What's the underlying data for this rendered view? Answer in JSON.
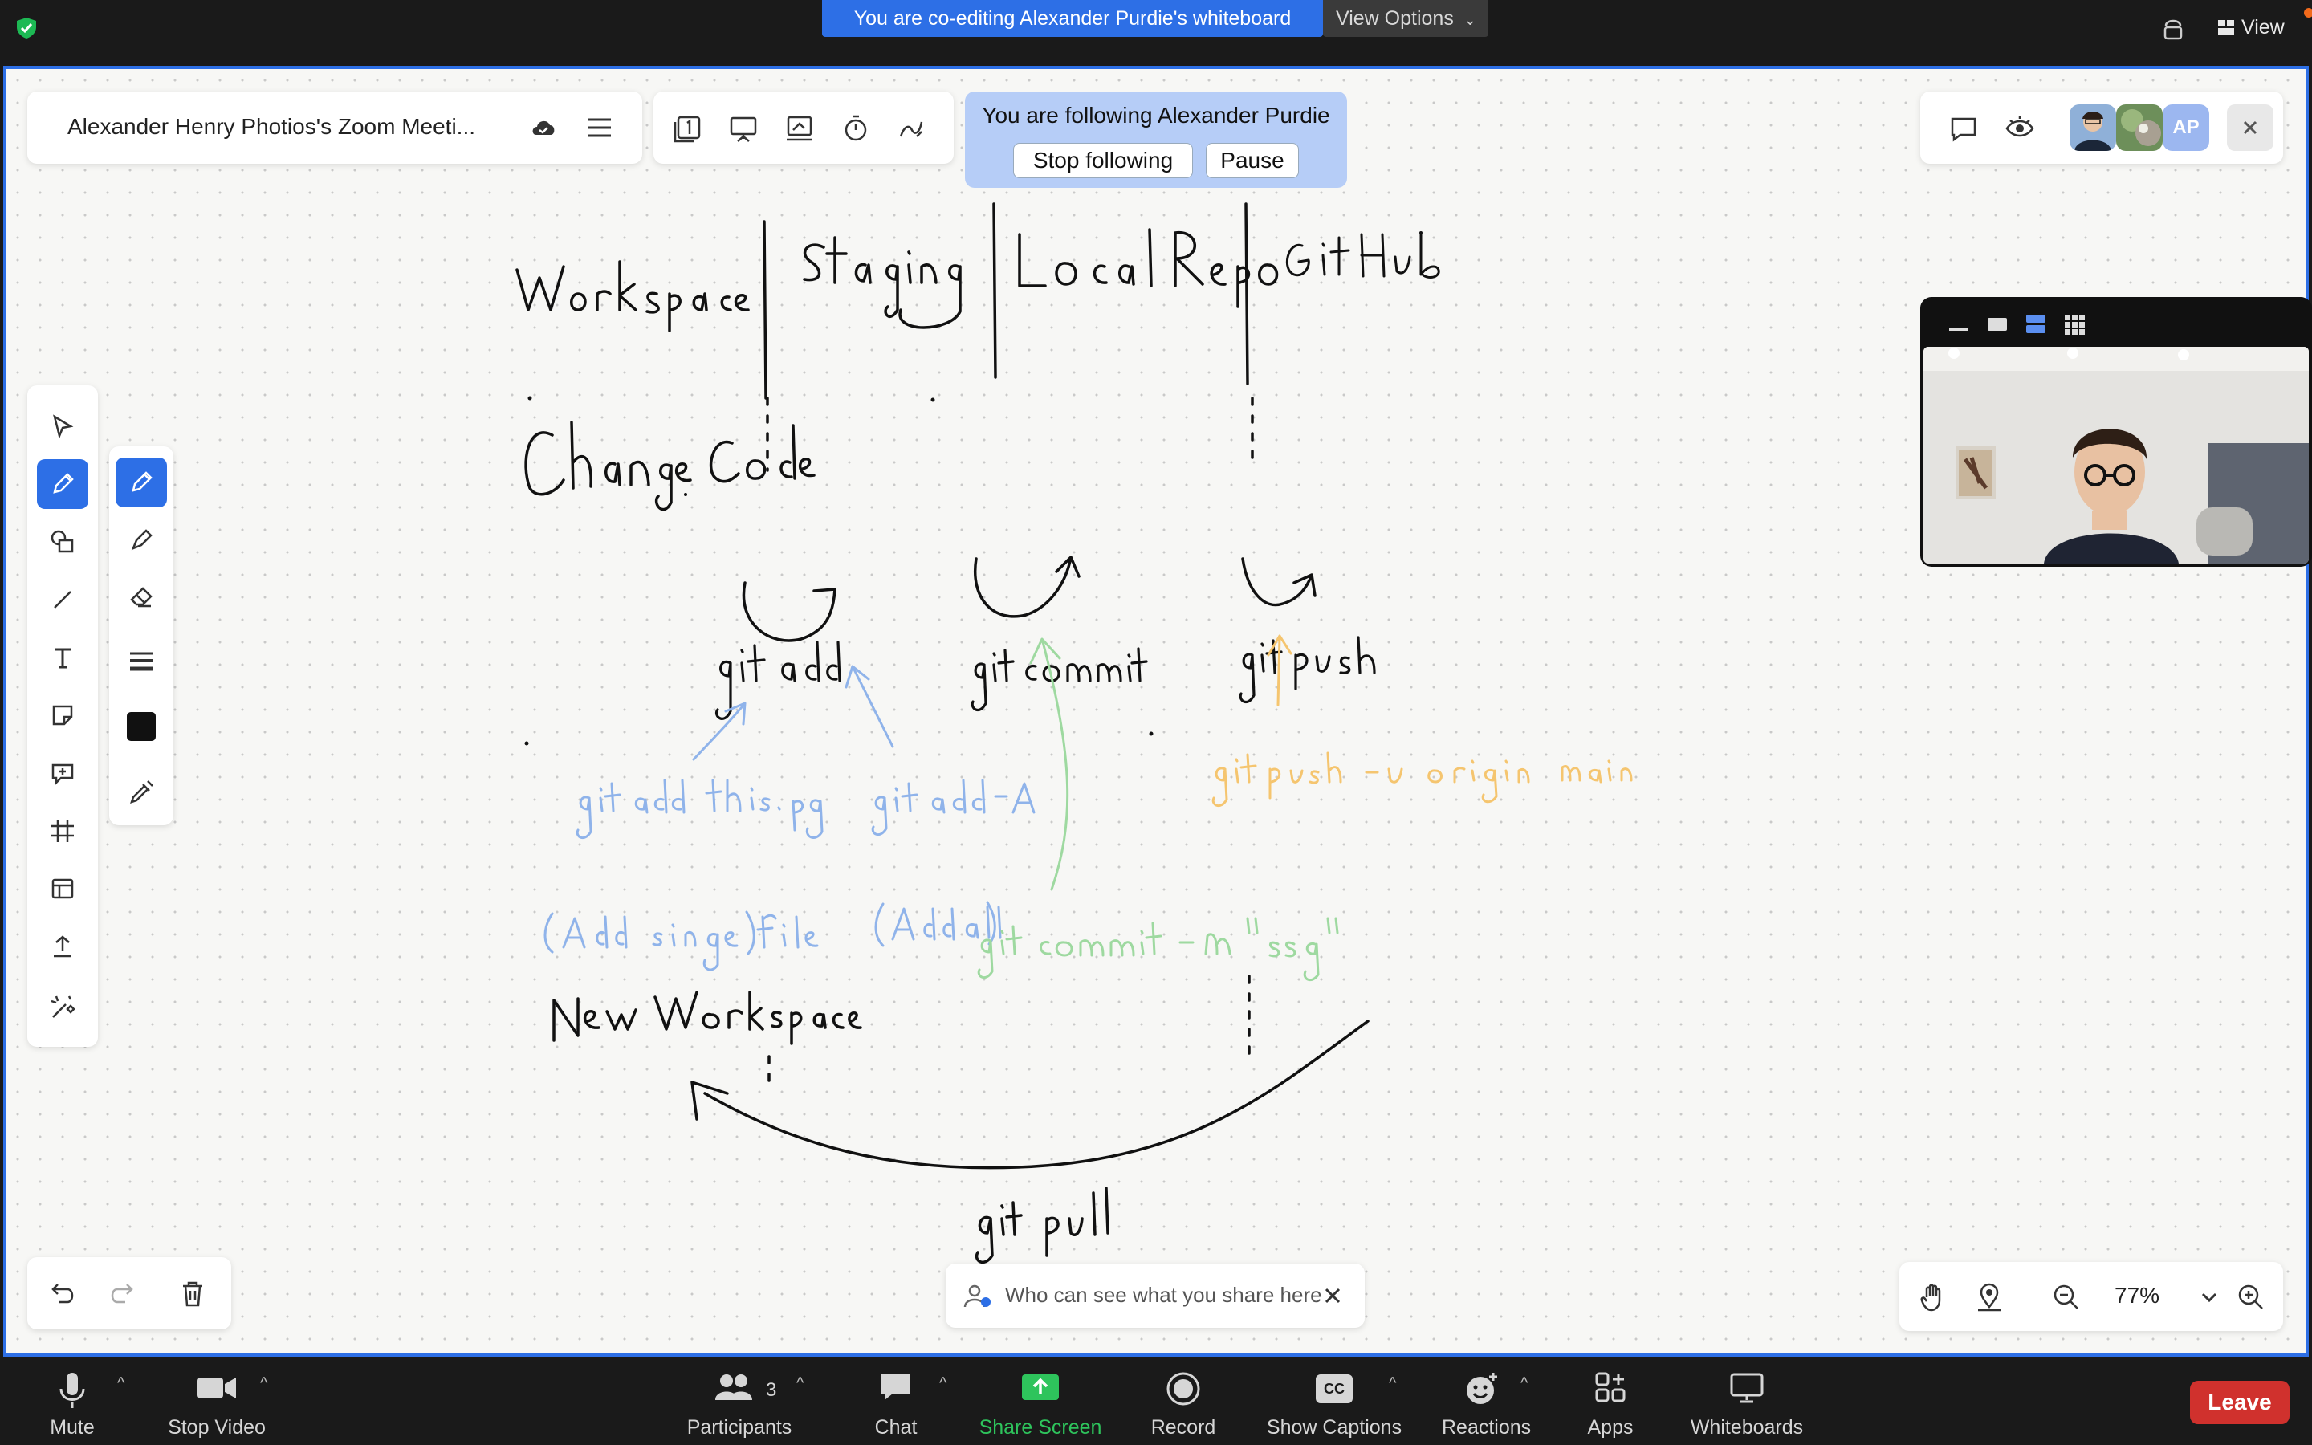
{
  "banner": {
    "coedit": "You are co-editing Alexander Purdie's whiteboard",
    "view_options": "View Options",
    "view": "View"
  },
  "whiteboard": {
    "meeting_title": "Alexander Henry Photios's Zoom Meeti...",
    "follow_text": "You are following Alexander Purdie",
    "stop_following": "Stop following",
    "pause": "Pause",
    "avatar_initials": "AP",
    "share_notice": "Who can see what you share here",
    "zoom_level": "77%"
  },
  "colors": {
    "accent": "#2d6fe6",
    "follow_bg": "#b6cdf7",
    "ink_black": "#111111",
    "ink_blue": "#8fb3ea",
    "ink_green": "#9ed9a0",
    "ink_orange": "#f5c56f",
    "leave": "#d0312d"
  },
  "controls": {
    "mute": "Mute",
    "stop_video": "Stop Video",
    "participants": "Participants",
    "participants_count": "3",
    "chat": "Chat",
    "share_screen": "Share Screen",
    "record": "Record",
    "show_captions": "Show Captions",
    "reactions": "Reactions",
    "apps": "Apps",
    "whiteboards": "Whiteboards",
    "leave": "Leave"
  },
  "icons": {
    "cc_label": "CC"
  }
}
